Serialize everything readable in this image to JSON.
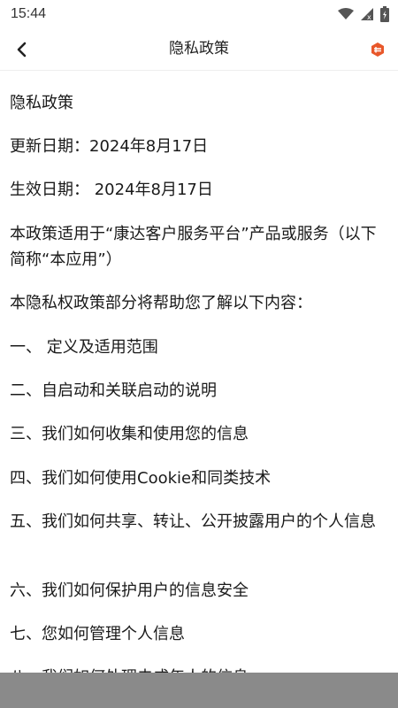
{
  "status_bar": {
    "time": "15:44",
    "icons": [
      "wifi-icon",
      "signal-icon",
      "battery-icon"
    ]
  },
  "app_bar": {
    "title": "隐私政策",
    "back_icon": "chevron-left-icon",
    "action_icon": "brand-logo-icon"
  },
  "colors": {
    "accent": "#e8572a",
    "background": "#ffffff",
    "text": "#1a1a1a",
    "bottom_overlay": "#8a8a8a"
  },
  "content": {
    "heading": "隐私政策",
    "updated": "更新日期：2024年8月17日",
    "effective": "生效日期： 2024年8月17日",
    "scope": "本政策适用于“康达客户服务平台”产品或服务（以下简称“本应用”）",
    "intro": "本隐私权政策部分将帮助您了解以下内容：",
    "items": [
      "一、  定义及适用范围",
      "二、自启动和关联启动的说明",
      "三、我们如何收集和使用您的信息",
      "四、我们如何使用Cookie和同类技术",
      "五、我们如何共享、转让、公开披露用户的个人信息",
      "六、我们如何保护用户的信息安全",
      "七、您如何管理个人信息",
      "八、我们如何处理未成年人的信息"
    ]
  }
}
